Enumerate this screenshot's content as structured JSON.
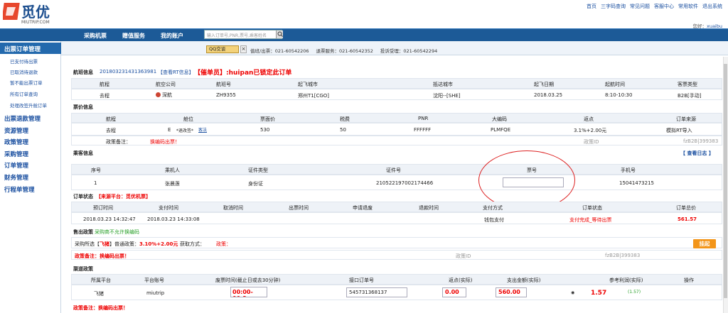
{
  "header": {
    "logo_text": "觅优",
    "logo_sub": "MIUTRIP.COM",
    "links": [
      "首页",
      "三字码查询",
      "常见问题",
      "客服中心",
      "常用软件",
      "退出系统"
    ],
    "greeting": "您好：",
    "user": "xuaibu"
  },
  "nav": {
    "items": [
      "采购机票",
      "赠值服务",
      "我的账户"
    ],
    "search_placeholder": "输入订单号,PNR,票号,乘客姓名"
  },
  "strip": {
    "qq": "QQ交谈",
    "phones": [
      "值班/出票：021-60542206",
      "退票服务：021-60542352",
      "投诉受理：021-60542294"
    ]
  },
  "sidebar": {
    "head": "出票订单管理",
    "subs": [
      "已支付待出票",
      "已取消待退款",
      "暂不能出票订单",
      "所有订单查询",
      "处理改签升舱订单"
    ],
    "cats": [
      "出票退款管理",
      "资源管理",
      "政策管理",
      "采购管理",
      "订单管理",
      "财务管理",
      "行程单管理"
    ]
  },
  "flight": {
    "title": "航班信息",
    "order_no": "201803231431363981",
    "rt_link": "【查看RT信息】",
    "lock_text": "【催单员】:huipan已锁定此订单",
    "headers": [
      "航程",
      "航空公司",
      "航班号",
      "起飞城市",
      "抵达城市",
      "起飞日期",
      "起航时间",
      "客票类型"
    ],
    "row": [
      "去程",
      "深航",
      "ZH9355",
      "郑州T1[CGO]",
      "沈阳--[SHE]",
      "2018.03.25",
      "8:10-10:30",
      "B2B[手动]"
    ]
  },
  "ticket": {
    "title": "票价信息",
    "headers": [
      "航程",
      "舱位",
      "票面价",
      "税费",
      "PNR",
      "大编码",
      "返点",
      "订单来源"
    ],
    "row": [
      "去程",
      "E",
      "*退改签*",
      "客法",
      "530",
      "50",
      "FFFFFF",
      "PLMFQE",
      "3.1%+2.00元",
      "模拟RT导入"
    ],
    "remark_label": "政策备注：",
    "remark": "换编码出票！",
    "policy_id_label": "政策ID",
    "policy_id": "fzB2B|399383"
  },
  "passenger": {
    "title": "乘客信息",
    "log_link": "【 查看日志 】",
    "headers": [
      "序号",
      "乘机人",
      "证件类型",
      "证件号",
      "票号",
      "手机号"
    ],
    "row": [
      "1",
      "张晨莲",
      "身份证",
      "210522197002174466",
      "",
      "15041473215"
    ]
  },
  "status": {
    "title": "订单状态",
    "source": "【来源平台：觅优机票】",
    "headers": [
      "预订时间",
      "支付时间",
      "取消时间",
      "出票时间",
      "申请退废",
      "退款时间",
      "支付方式",
      "订单状态",
      "订单总价"
    ],
    "row": [
      "2018.03.23 14:32:47",
      "2018.03.23 14:33:08",
      "",
      "",
      "",
      "",
      "钱包支付",
      "支付完成_等待出票",
      "561.57"
    ]
  },
  "sale": {
    "title": "售出政策",
    "note": "采购商不允许换编码",
    "line_prefix": "采购所选【",
    "line_air": "飞猪",
    "line_mid": "】普通政策：",
    "line_rate": "3.10%+2.00元",
    "line_get": "获取方式：",
    "line_policy": "政策：",
    "remark": "政策备注：换编码出票！",
    "policy_id_label": "政策ID",
    "policy_id": "fzB2B|399383",
    "suspend": "挂起"
  },
  "channel": {
    "title": "渠道政策",
    "headers": [
      "所属平台",
      "平台账号",
      "废票时间(截止日或去30分钟)",
      "接口订单号",
      "返点(实际)",
      "支出金额(实际)",
      "参考利润(实际)",
      "操作"
    ],
    "row": [
      "飞猪",
      "miutrip",
      "00:00-00:2",
      "545731368137",
      "0.00",
      "560.00",
      "1.57",
      "(1.57)"
    ],
    "remark": "政策备注：换编码出票！"
  }
}
